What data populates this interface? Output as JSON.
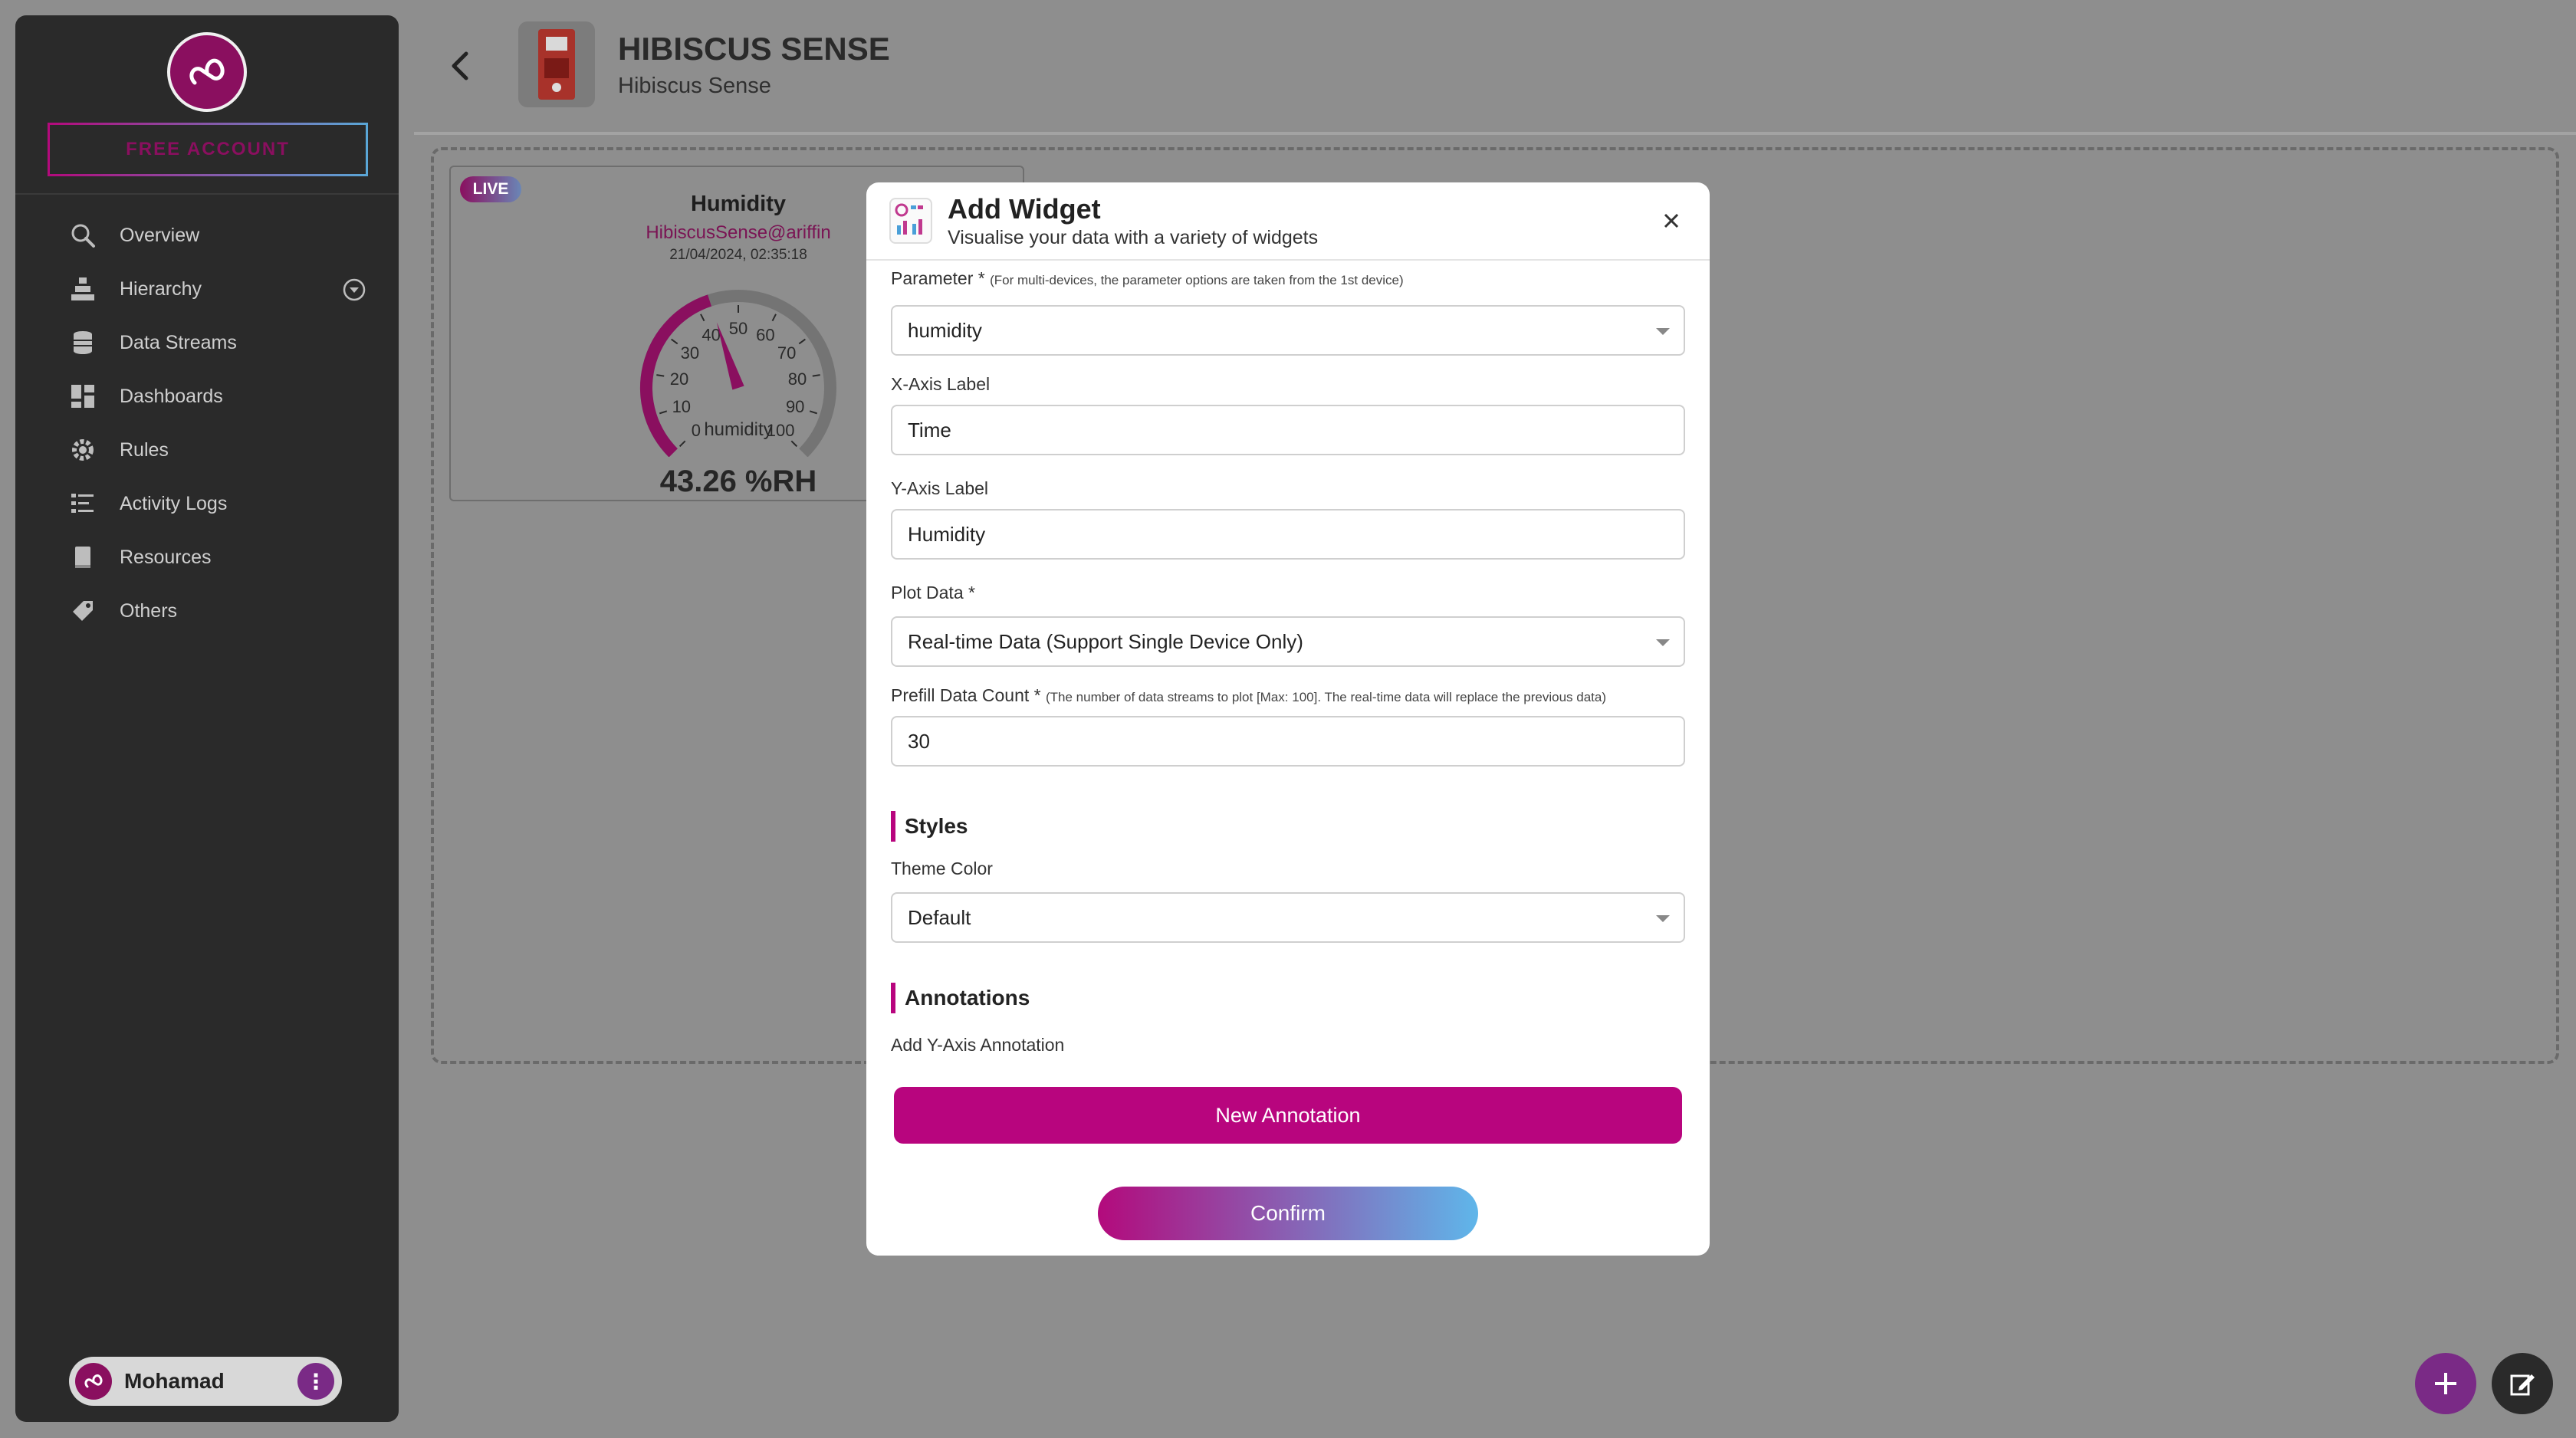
{
  "sidebar": {
    "free_account": "FREE ACCOUNT",
    "items": [
      {
        "label": "Overview",
        "icon": "search-icon"
      },
      {
        "label": "Hierarchy",
        "icon": "hierarchy-icon"
      },
      {
        "label": "Data Streams",
        "icon": "database-icon"
      },
      {
        "label": "Dashboards",
        "icon": "dashboard-icon"
      },
      {
        "label": "Rules",
        "icon": "gear-icon"
      },
      {
        "label": "Activity Logs",
        "icon": "list-icon"
      },
      {
        "label": "Resources",
        "icon": "book-icon"
      },
      {
        "label": "Others",
        "icon": "tag-icon"
      }
    ],
    "user_name": "Mohamad"
  },
  "header": {
    "title": "HIBISCUS SENSE",
    "subtitle": "Hibiscus Sense"
  },
  "widget": {
    "badge": "LIVE",
    "title": "Humidity",
    "device": "HibiscusSense@ariffin",
    "timestamp": "21/04/2024, 02:35:18",
    "gauge_label": "humidity",
    "gauge_ticks": [
      "0",
      "10",
      "20",
      "30",
      "40",
      "50",
      "60",
      "70",
      "80",
      "90",
      "100"
    ],
    "gauge_value": 43.26,
    "value_text": "43.26 %RH"
  },
  "modal": {
    "title": "Add Widget",
    "subtitle": "Visualise your data with a variety of widgets",
    "parameter_label": "Parameter *",
    "parameter_note": "(For multi-devices, the parameter options are taken from the 1st device)",
    "parameter_value": "humidity",
    "xaxis_label": "X-Axis Label",
    "xaxis_value": "Time",
    "yaxis_label": "Y-Axis Label",
    "yaxis_value": "Humidity",
    "plot_label": "Plot Data *",
    "plot_value": "Real-time Data (Support Single Device Only)",
    "prefill_label": "Prefill Data Count *",
    "prefill_note": "(The number of data streams to plot [Max: 100]. The real-time data will replace the previous data)",
    "prefill_value": "30",
    "styles_heading": "Styles",
    "theme_label": "Theme Color",
    "theme_value": "Default",
    "annotations_heading": "Annotations",
    "add_y_annotation": "Add Y-Axis Annotation",
    "new_annotation_button": "New Annotation",
    "confirm_button": "Confirm"
  },
  "colors": {
    "accent": "#b8057e",
    "sidebar_bg": "#2a2a2a",
    "overlay": "#8e8e8e"
  }
}
